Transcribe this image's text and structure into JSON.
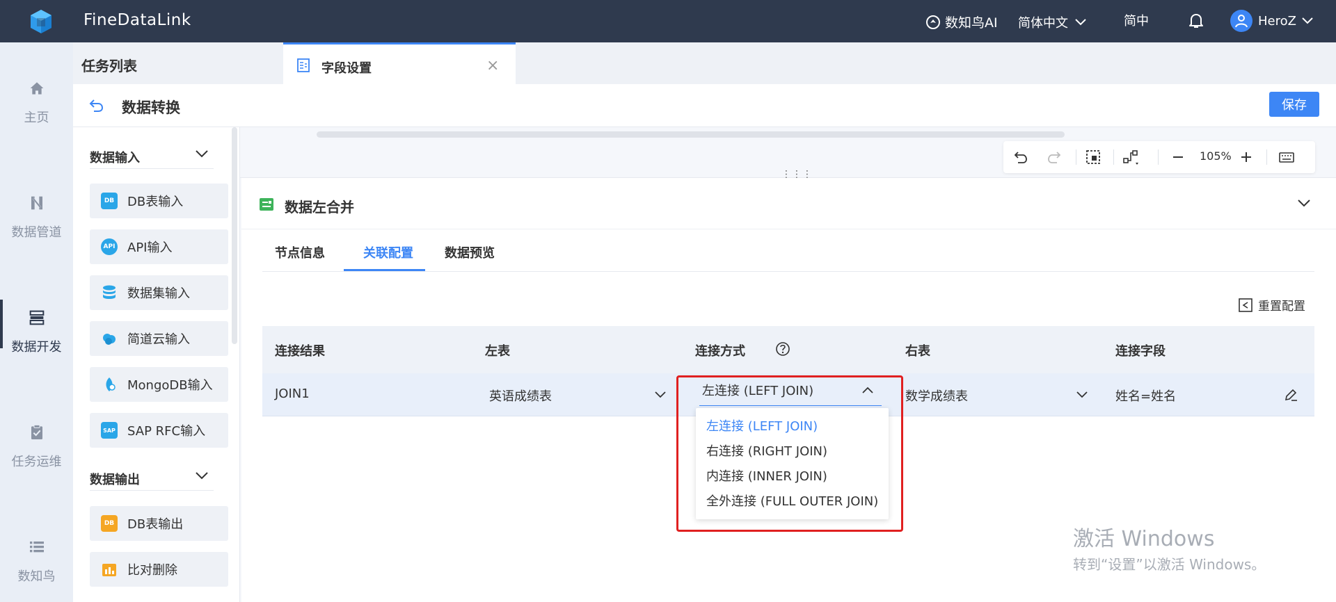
{
  "topbar": {
    "app_title": "FineDataLink",
    "ai_label": "数知鸟AI",
    "language": "简体中文",
    "simplified": "简中",
    "username": "HeroZ"
  },
  "leftnav": {
    "items": [
      {
        "label": "主页"
      },
      {
        "label": "数据管道"
      },
      {
        "label": "数据开发"
      },
      {
        "label": "任务运维"
      },
      {
        "label": "数知鸟"
      }
    ]
  },
  "tabbar": {
    "task_list": "任务列表",
    "active_tab": "字段设置",
    "close": "×"
  },
  "header": {
    "title": "数据转换",
    "save_label": "保存"
  },
  "panel": {
    "groups": [
      {
        "title": "数据输入",
        "items": [
          "DB表输入",
          "API输入",
          "数据集输入",
          "简道云输入",
          "MongoDB输入",
          "SAP RFC输入"
        ]
      },
      {
        "title": "数据输出",
        "items": [
          "DB表输出",
          "比对删除"
        ]
      }
    ]
  },
  "toolbar": {
    "zoom": "105%",
    "handle": "⋮⋮⋮"
  },
  "config": {
    "node_title": "数据左合并",
    "tabs": [
      "节点信息",
      "关联配置",
      "数据预览"
    ],
    "active_tab": "关联配置",
    "reset_label": "重置配置",
    "columns": [
      "连接结果",
      "左表",
      "连接方式",
      "右表",
      "连接字段"
    ],
    "row": {
      "result": "JOIN1",
      "left_table": "英语成绩表",
      "join_type": "左连接 (LEFT JOIN)",
      "right_table": "数学成绩表",
      "join_field": "姓名=姓名"
    },
    "join_options": [
      "左连接 (LEFT JOIN)",
      "右连接 (RIGHT JOIN)",
      "内连接 (INNER JOIN)",
      "全外连接 (FULL OUTER JOIN)"
    ]
  },
  "watermark": {
    "line1": "激活 Windows",
    "line2": "转到“设置”以激活 Windows。"
  },
  "colors": {
    "topbar_bg": "#2f3a4e",
    "accent": "#3d86f5",
    "highlight": "#e02020"
  }
}
